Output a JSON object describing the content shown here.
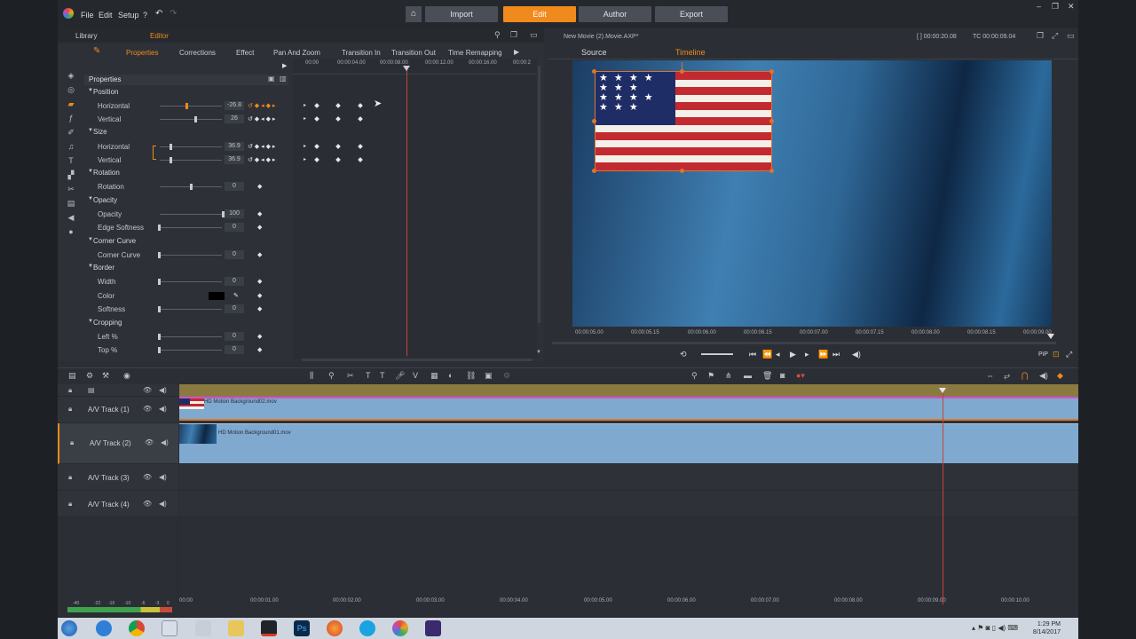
{
  "menu": {
    "file": "File",
    "edit": "Edit",
    "setup": "Setup",
    "help": "?"
  },
  "nav": {
    "import": "Import",
    "edit": "Edit",
    "author": "Author",
    "export": "Export"
  },
  "library": {
    "library_tab": "Library",
    "editor_tab": "Editor"
  },
  "prop_tabs": [
    "Properties",
    "Corrections",
    "Effect",
    "Pan And Zoom",
    "Transition In",
    "Transition Out",
    "Time Remapping"
  ],
  "kf_ruler": [
    "00:00",
    "00:00:04.00",
    "00:00:08.00",
    "00:00:12.00",
    "00:00:16.00",
    "00:00:2"
  ],
  "properties_header": "Properties",
  "props": {
    "position": "Position",
    "pos_h": "Horizontal",
    "pos_h_val": "-26.8",
    "pos_v": "Vertical",
    "pos_v_val": "26",
    "size": "Size",
    "size_h": "Horizontal",
    "size_h_val": "36.9",
    "size_v": "Vertical",
    "size_v_val": "36.9",
    "rotation_sec": "Rotation",
    "rotation": "Rotation",
    "rotation_val": "0",
    "opacity_sec": "Opacity",
    "opacity": "Opacity",
    "opacity_val": "100",
    "edge": "Edge Softness",
    "edge_val": "0",
    "corner_sec": "Corner Curve",
    "corner": "Corner Curve",
    "corner_val": "0",
    "border_sec": "Border",
    "width": "Width",
    "width_val": "0",
    "color": "Color",
    "softness": "Softness",
    "softness_val": "0",
    "cropping_sec": "Cropping",
    "left": "Left %",
    "left_val": "0",
    "top": "Top %",
    "top_val": "0"
  },
  "preview": {
    "title": "New Movie (2).Movie.AXP*",
    "tc_duration": "[ ] 00:00:20.08",
    "tc_current": "TC 00:00:09.04",
    "source_tab": "Source",
    "timeline_tab": "Timeline",
    "pip": "PiP",
    "ruler": [
      "00:00:05.00",
      "00:00:05.15",
      "00:00:06.00",
      "00:00:06.15",
      "00:00:07.00",
      "00:00:07.15",
      "00:00:08.00",
      "00:00:08.15",
      "00:00:09.00"
    ]
  },
  "tracks": [
    {
      "name": "A/V Track (1)",
      "clip": "HD Motion Background02.mov"
    },
    {
      "name": "A/V Track (2)",
      "clip": "HD Motion Background01.mov"
    },
    {
      "name": "A/V Track (3)"
    },
    {
      "name": "A/V Track (4)"
    }
  ],
  "tl_ruler": [
    "00:00",
    "00:00:01.00",
    "00:00:02.00",
    "00:00:03.00",
    "00:00:04.00",
    "00:00:05.00",
    "00:00:06.00",
    "00:00:07.00",
    "00:00:08.00",
    "00:00:09.00",
    "00:00:10.00"
  ],
  "meter_labels": [
    "-40",
    "-22",
    "-16",
    "-10",
    "-6",
    "-3",
    "0"
  ],
  "clock": {
    "time": "1:29 PM",
    "date": "8/14/2017"
  },
  "colors": {
    "accent": "#f08a1c",
    "clip": "#7fa9cf",
    "playhead": "#c0443a"
  }
}
